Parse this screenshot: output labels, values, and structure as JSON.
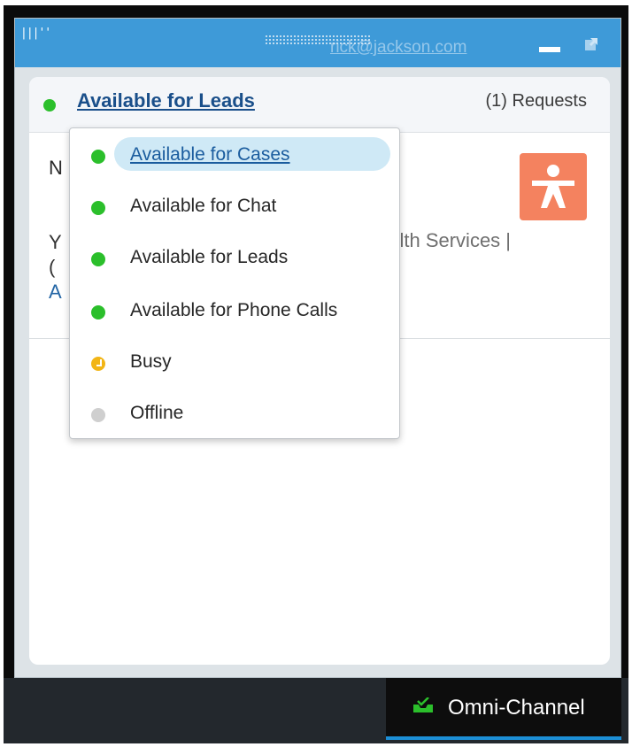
{
  "titlebar": {
    "email": "rick@jackson.com",
    "grip": "|||''"
  },
  "status": {
    "current": "Available for Leads",
    "requests": "(1) Requests"
  },
  "background_text": {
    "initial": "N",
    "line_y": "Y",
    "line_paren": "(",
    "line_a": "A",
    "services": "ealth Services |"
  },
  "dropdown": {
    "items": [
      {
        "label": "Available for Cases",
        "status": "available",
        "selected": true
      },
      {
        "label": "Available for Chat",
        "status": "available"
      },
      {
        "label": "Available for Leads",
        "status": "available"
      },
      {
        "label": "Available for Phone Calls",
        "status": "available"
      },
      {
        "label": "Busy",
        "status": "busy"
      },
      {
        "label": "Offline",
        "status": "offline"
      }
    ]
  },
  "footer": {
    "tab_label": "Omni-Channel",
    "tab_icon": "inbox-check-icon"
  },
  "colors": {
    "available": "#2bbf2b",
    "busy": "#f2b516",
    "offline": "#cfcfcf",
    "titlebar": "#3e9ad8",
    "link": "#1a4f8a",
    "avatar_bg": "#f4825f"
  }
}
